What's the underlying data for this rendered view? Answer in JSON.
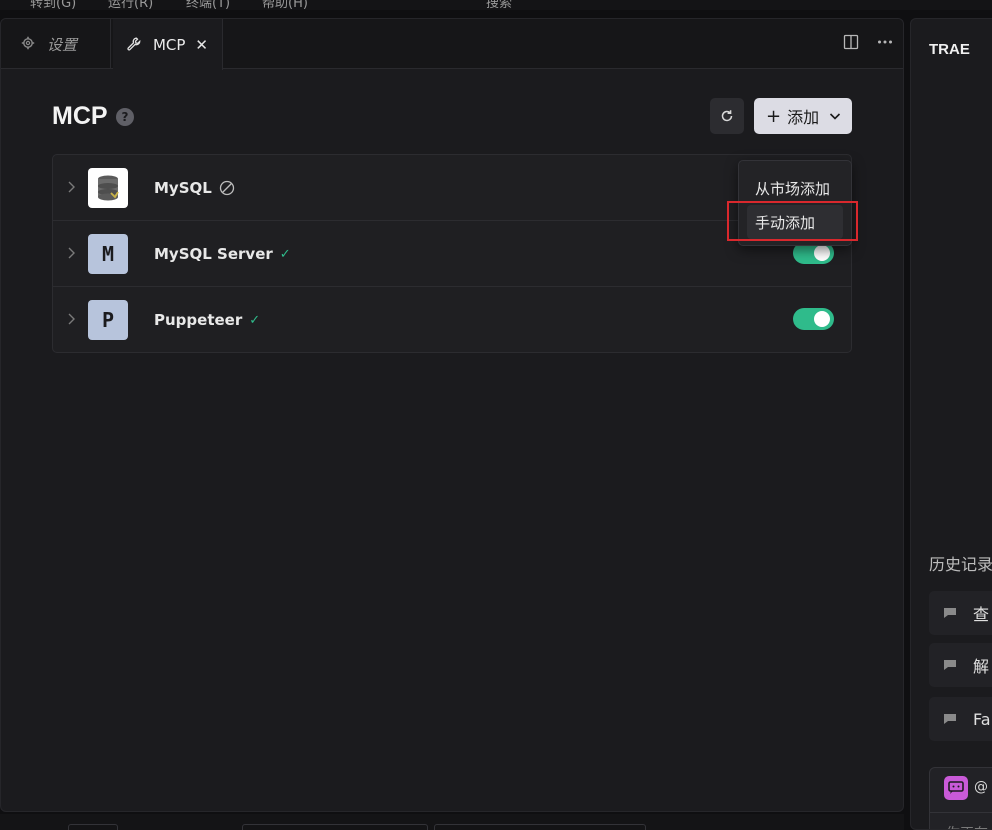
{
  "menubar": {
    "items": [
      "转到(G)",
      "运行(R)",
      "终端(T)",
      "帮助(H)",
      "搜索"
    ]
  },
  "tabs": [
    {
      "label": "设置",
      "icon": "gear-icon",
      "active": false
    },
    {
      "label": "MCP",
      "icon": "wrench-icon",
      "active": true,
      "close": "✕"
    }
  ],
  "page": {
    "title": "MCP",
    "help": "?",
    "add_label": "添加"
  },
  "servers": [
    {
      "name": "MySQL",
      "logo": "database-icon",
      "status": "disabled"
    },
    {
      "name": "MySQL Server",
      "logo_letter": "M",
      "status": "ok",
      "enabled": true
    },
    {
      "name": "Puppeteer",
      "logo_letter": "P",
      "status": "ok",
      "enabled": true
    }
  ],
  "add_menu": {
    "items": [
      "从市场添加",
      "手动添加"
    ],
    "highlighted": "手动添加"
  },
  "right_panel": {
    "brand": "TRAE",
    "history_title": "历史记录",
    "history": [
      "查",
      "解",
      "Fa"
    ],
    "chat_at": "@",
    "chat_placeholder": "你正在"
  },
  "colors": {
    "accent_green": "#2fbb8b",
    "highlight_red": "#d9282d",
    "chat_icon": "#c95ad8"
  }
}
